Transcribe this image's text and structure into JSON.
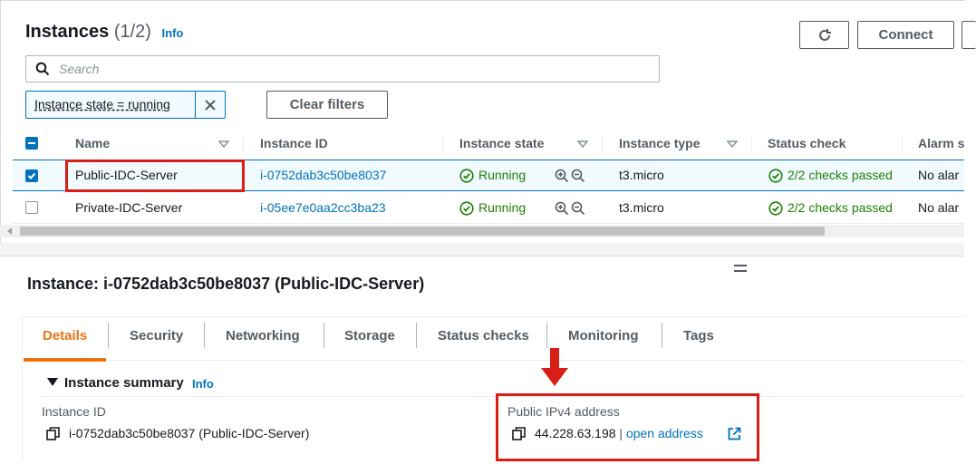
{
  "header": {
    "title": "Instances",
    "count": "(1/2)",
    "info": "Info",
    "connect_label": "Connect"
  },
  "search": {
    "placeholder": "Search"
  },
  "filter": {
    "token": "Instance state = running",
    "clear_label": "Clear filters"
  },
  "columns": [
    "Name",
    "Instance ID",
    "Instance state",
    "Instance type",
    "Status check",
    "Alarm s"
  ],
  "rows": [
    {
      "name": "Public-IDC-Server",
      "id": "i-0752dab3c50be8037",
      "state": "Running",
      "type": "t3.micro",
      "status": "2/2 checks passed",
      "alarm": "No alar",
      "selected": true
    },
    {
      "name": "Private-IDC-Server",
      "id": "i-05ee7e0aa2cc3ba23",
      "state": "Running",
      "type": "t3.micro",
      "status": "2/2 checks passed",
      "alarm": "No alar",
      "selected": false
    }
  ],
  "detail": {
    "title": "Instance: i-0752dab3c50be8037 (Public-IDC-Server)",
    "tabs": [
      "Details",
      "Security",
      "Networking",
      "Storage",
      "Status checks",
      "Monitoring",
      "Tags"
    ],
    "active_tab": "Details",
    "summary_label": "Instance summary",
    "summary_info": "Info",
    "instance_id_label": "Instance ID",
    "instance_id_value": "i-0752dab3c50be8037 (Public-IDC-Server)",
    "ipv4_label": "Public IPv4 address",
    "ipv4_value": "44.228.63.198",
    "ipv4_sep": "|",
    "open_address": "open address"
  },
  "colors": {
    "link": "#0073bb",
    "accent": "#ec7211",
    "success": "#1d8102",
    "annotation": "#d91e18"
  },
  "icons": [
    "refresh-icon",
    "search-icon",
    "close-icon",
    "sort-icon",
    "check-circle-icon",
    "zoom-in-icon",
    "zoom-out-icon",
    "copy-icon",
    "external-link-icon",
    "drag-handle-icon",
    "down-arrow-annotation-icon",
    "caret-down-icon"
  ]
}
